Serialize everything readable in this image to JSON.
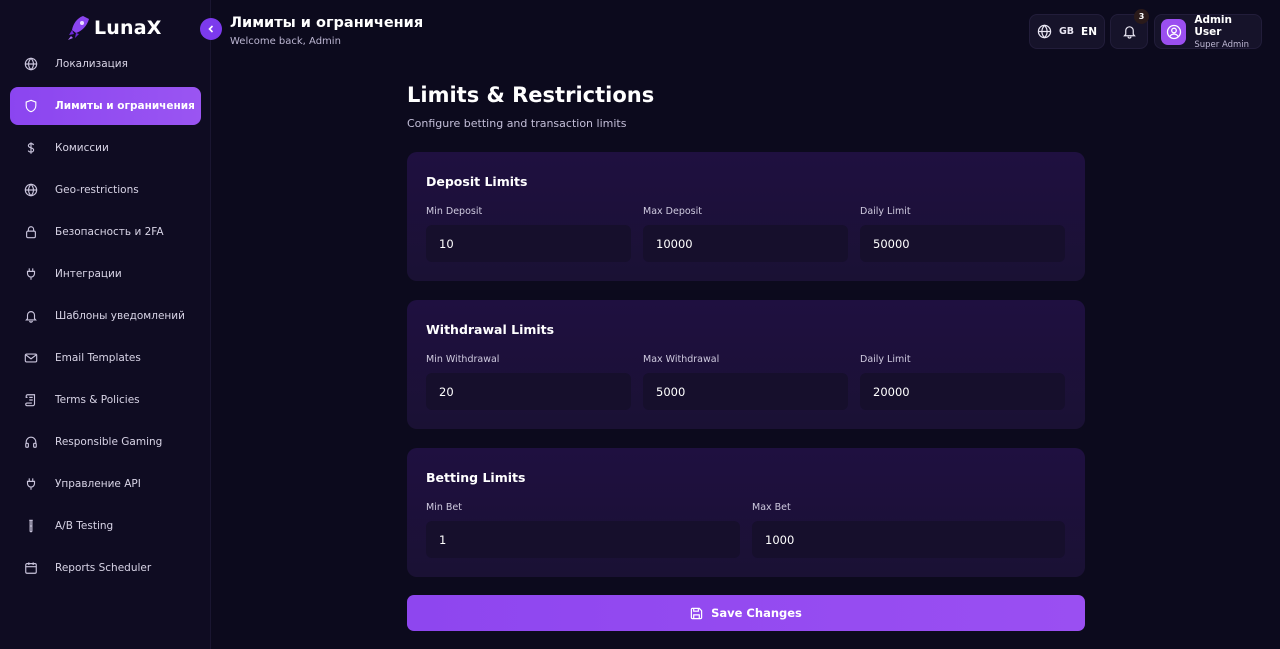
{
  "brand": {
    "name": "LunaX"
  },
  "sidebar": {
    "items": [
      {
        "label": "Локализация",
        "icon": "globe-icon"
      },
      {
        "label": "Лимиты и ограничения",
        "icon": "shield-icon",
        "active": true
      },
      {
        "label": "Комиссии",
        "icon": "dollar-icon"
      },
      {
        "label": "Geo-restrictions",
        "icon": "globe-icon"
      },
      {
        "label": "Безопасность и 2FA",
        "icon": "lock-icon"
      },
      {
        "label": "Интеграции",
        "icon": "plug-icon"
      },
      {
        "label": "Шаблоны уведомлений",
        "icon": "bell-icon"
      },
      {
        "label": "Email Templates",
        "icon": "mail-icon"
      },
      {
        "label": "Terms & Policies",
        "icon": "scroll-icon"
      },
      {
        "label": "Responsible Gaming",
        "icon": "headphones-icon"
      },
      {
        "label": "Управление API",
        "icon": "plug-icon"
      },
      {
        "label": "A/B Testing",
        "icon": "flask-icon"
      },
      {
        "label": "Reports Scheduler",
        "icon": "calendar-icon"
      }
    ]
  },
  "header": {
    "title": "Лимиты и ограничения",
    "subtitle": "Welcome back, Admin",
    "language": {
      "code": "GB",
      "name": "EN"
    },
    "notifications": {
      "count": "3"
    },
    "user": {
      "name": "Admin User",
      "role": "Super Admin"
    }
  },
  "main": {
    "title": "Limits & Restrictions",
    "subtitle": "Configure betting and transaction limits",
    "deposit": {
      "title": "Deposit Limits",
      "fields": [
        {
          "label": "Min Deposit",
          "value": "10"
        },
        {
          "label": "Max Deposit",
          "value": "10000"
        },
        {
          "label": "Daily Limit",
          "value": "50000"
        }
      ]
    },
    "withdrawal": {
      "title": "Withdrawal Limits",
      "fields": [
        {
          "label": "Min Withdrawal",
          "value": "20"
        },
        {
          "label": "Max Withdrawal",
          "value": "5000"
        },
        {
          "label": "Daily Limit",
          "value": "20000"
        }
      ]
    },
    "betting": {
      "title": "Betting Limits",
      "fields": [
        {
          "label": "Min Bet",
          "value": "1"
        },
        {
          "label": "Max Bet",
          "value": "1000"
        }
      ]
    },
    "save_label": "Save Changes"
  },
  "colors": {
    "accent": "#8b45f0",
    "background": "#0c0a1d",
    "card": "#1f1040",
    "input": "#160f2c"
  }
}
